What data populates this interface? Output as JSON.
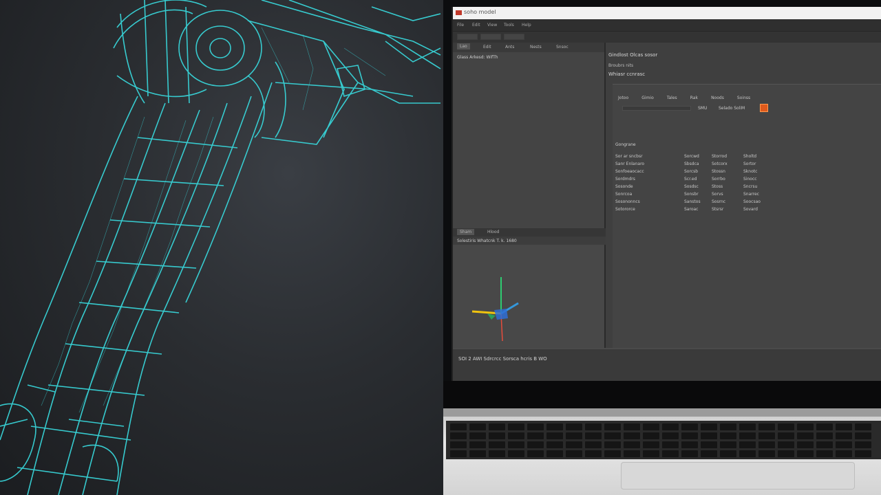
{
  "window": {
    "title": "soho model"
  },
  "menubar": {
    "items": [
      "File",
      "Edit",
      "View",
      "Tools",
      "Help"
    ]
  },
  "outliner": {
    "tabs": [
      "Lao",
      "Edit",
      "Ants",
      "Nests",
      "Snsoc"
    ],
    "row": "Glass Arkesd: WifTh"
  },
  "viewport": {
    "tabs": [
      "Sham",
      "Hlood"
    ],
    "info": "Solestiris  Whatcnk  T. k.  1680"
  },
  "properties": {
    "title": "Gindlost Olcas  sosor",
    "subtitle": "Broubrs  nits",
    "section": "Whiasr ccnrasc",
    "tabs": [
      "Jotoo",
      "Gimio",
      "Tales",
      "Rak",
      "Noods",
      "Soinss"
    ],
    "swatch_label": "SMU",
    "swatch_text": "Selado  SoliM",
    "group_label": "Gongrane",
    "rows": [
      {
        "label": "Sor ar sncbsr",
        "c1": "Sorcwd",
        "c2": "Storrod",
        "c3": "Sholtd"
      },
      {
        "label": "Sanr Enlanaro",
        "c1": "Sbsdca",
        "c2": "Sotcorx",
        "c3": "Sortor"
      },
      {
        "label": "Sonfoeaocacc",
        "c1": "Sorcsb",
        "c2": "Stossn",
        "c3": "Sknotc"
      },
      {
        "label": "Sordmdrs",
        "c1": "Scr.ed",
        "c2": "Sorrbo",
        "c3": "Sinocc"
      },
      {
        "label": "Sosonde",
        "c1": "Sosdsc",
        "c2": "Stoss",
        "c3": "Sncrsu"
      },
      {
        "label": "Sonrcoa",
        "c1": "Sonsbr",
        "c2": "Sorvs",
        "c3": "Snarrec"
      },
      {
        "label": "Sosononncs",
        "c1": "Sanstos",
        "c2": "Sosrnc",
        "c3": "Soocsao"
      },
      {
        "label": "Sotororce",
        "c1": "Saroac",
        "c2": "Stsrsr",
        "c3": "Sovard"
      }
    ]
  },
  "statusbar": {
    "text": "SOI  2  AWI  Sdrcrcc  Sorsca hcris  B  WO"
  },
  "colors": {
    "wireframe": "#38d4d8",
    "accent": "#e05a1c"
  }
}
